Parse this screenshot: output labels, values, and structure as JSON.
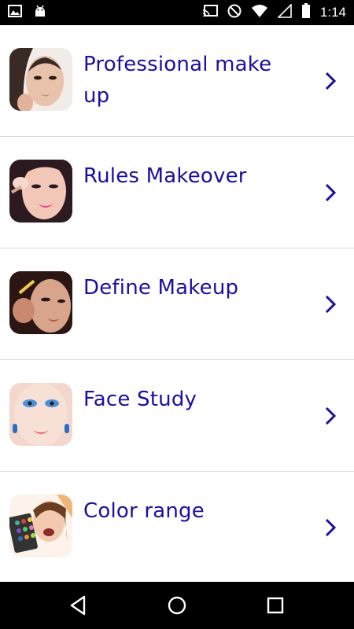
{
  "status_bar": {
    "time": "1:14",
    "left_icons": [
      "image-icon",
      "android-icon"
    ],
    "right_icons": [
      "cast-icon",
      "do-not-disturb-icon",
      "wifi-icon",
      "signal-icon",
      "battery-icon"
    ]
  },
  "items": [
    {
      "label": "Professional make up",
      "thumb_colors": [
        "#e9c2ab",
        "#3a2a26",
        "#c98b7a"
      ]
    },
    {
      "label": "Rules Makeover",
      "thumb_colors": [
        "#f2c7b8",
        "#2c1a20",
        "#e5457c"
      ]
    },
    {
      "label": "Define Makeup",
      "thumb_colors": [
        "#d8a58c",
        "#2b1614",
        "#b45c46"
      ]
    },
    {
      "label": "Face Study",
      "thumb_colors": [
        "#f4d7cc",
        "#4a8fd9",
        "#e45f7a"
      ]
    },
    {
      "label": "Color range",
      "thumb_colors": [
        "#f3c9b0",
        "#6b3e22",
        "#3bb3a8"
      ]
    }
  ],
  "nav_bar": {
    "buttons": [
      "back-icon",
      "home-icon",
      "recents-icon"
    ]
  },
  "colors": {
    "label_text": "#1a10a0",
    "chevron": "#1a10a0",
    "divider": "#d9d9d9"
  }
}
